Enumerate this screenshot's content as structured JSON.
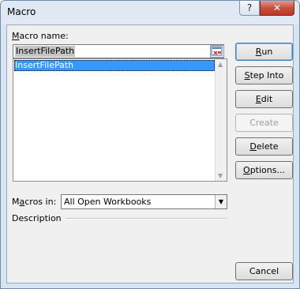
{
  "window": {
    "title": "Macro",
    "help_label": "?",
    "close_label": "✕"
  },
  "macro_name": {
    "label_accel": "M",
    "label_rest": "acro name:",
    "value": "InsertFilePath"
  },
  "macro_list": {
    "items": [
      "InsertFilePath"
    ],
    "selected_index": 0
  },
  "macros_in": {
    "label_pre": "M",
    "label_accel": "a",
    "label_rest": "cros in:",
    "value": "All Open Workbooks"
  },
  "description": {
    "label": "Description"
  },
  "buttons": {
    "run": {
      "accel": "R",
      "rest": "un"
    },
    "step_into": {
      "accel": "S",
      "rest": "tep Into"
    },
    "edit": {
      "accel": "E",
      "rest": "dit"
    },
    "create": {
      "label": "Create"
    },
    "delete": {
      "accel": "D",
      "rest": "elete"
    },
    "options": {
      "accel": "O",
      "rest": "ptions..."
    },
    "cancel": {
      "label": "Cancel"
    }
  },
  "icons": {
    "help": "question-mark-icon",
    "close": "close-icon",
    "ref": "collapse-dialog-icon",
    "scroll_up": "scroll-up-arrow-icon",
    "scroll_down": "scroll-down-arrow-icon",
    "dropdown": "chevron-down-icon"
  }
}
